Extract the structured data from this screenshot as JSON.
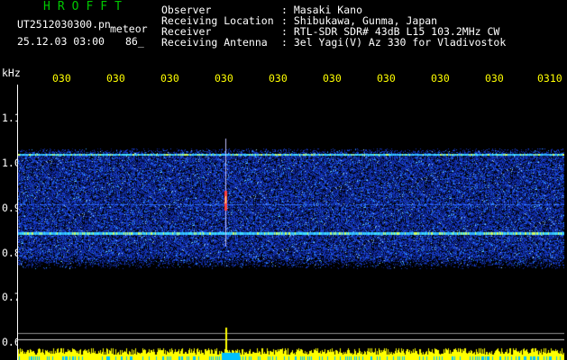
{
  "header": {
    "app_title": "HROFFT",
    "filename": "UT2512030300.pn",
    "meteor_label": "meteor",
    "datetime": "25.12.03 03:00",
    "count": "86_"
  },
  "info": [
    {
      "key": "Observer",
      "value": ": Masaki Kano"
    },
    {
      "key": "Receiving Location",
      "value": ": Shibukawa, Gunma, Japan"
    },
    {
      "key": "Receiver",
      "value": ": RTL-SDR SDR# 43dB L15 103.2MHz CW"
    },
    {
      "key": "Receiving Antenna",
      "value": ": 3el Yagi(V) Az 330 for Vladivostok"
    }
  ],
  "axis": {
    "y_unit": "kHz",
    "y_ticks": [
      "1.1",
      "1.0",
      "0.9",
      "0.8",
      "0.7",
      "0.6"
    ],
    "x_ticks": [
      "030",
      "030",
      "030",
      "030",
      "030",
      "030",
      "030",
      "030",
      "030",
      "0310"
    ]
  },
  "colors": {
    "background": "#000000",
    "title": "#00c800",
    "ticks": "#ffff00",
    "labels": "#ffffff",
    "signal_high": "#ffff00",
    "signal_mid": "#00d0ff",
    "noise": "#1030c0"
  }
}
